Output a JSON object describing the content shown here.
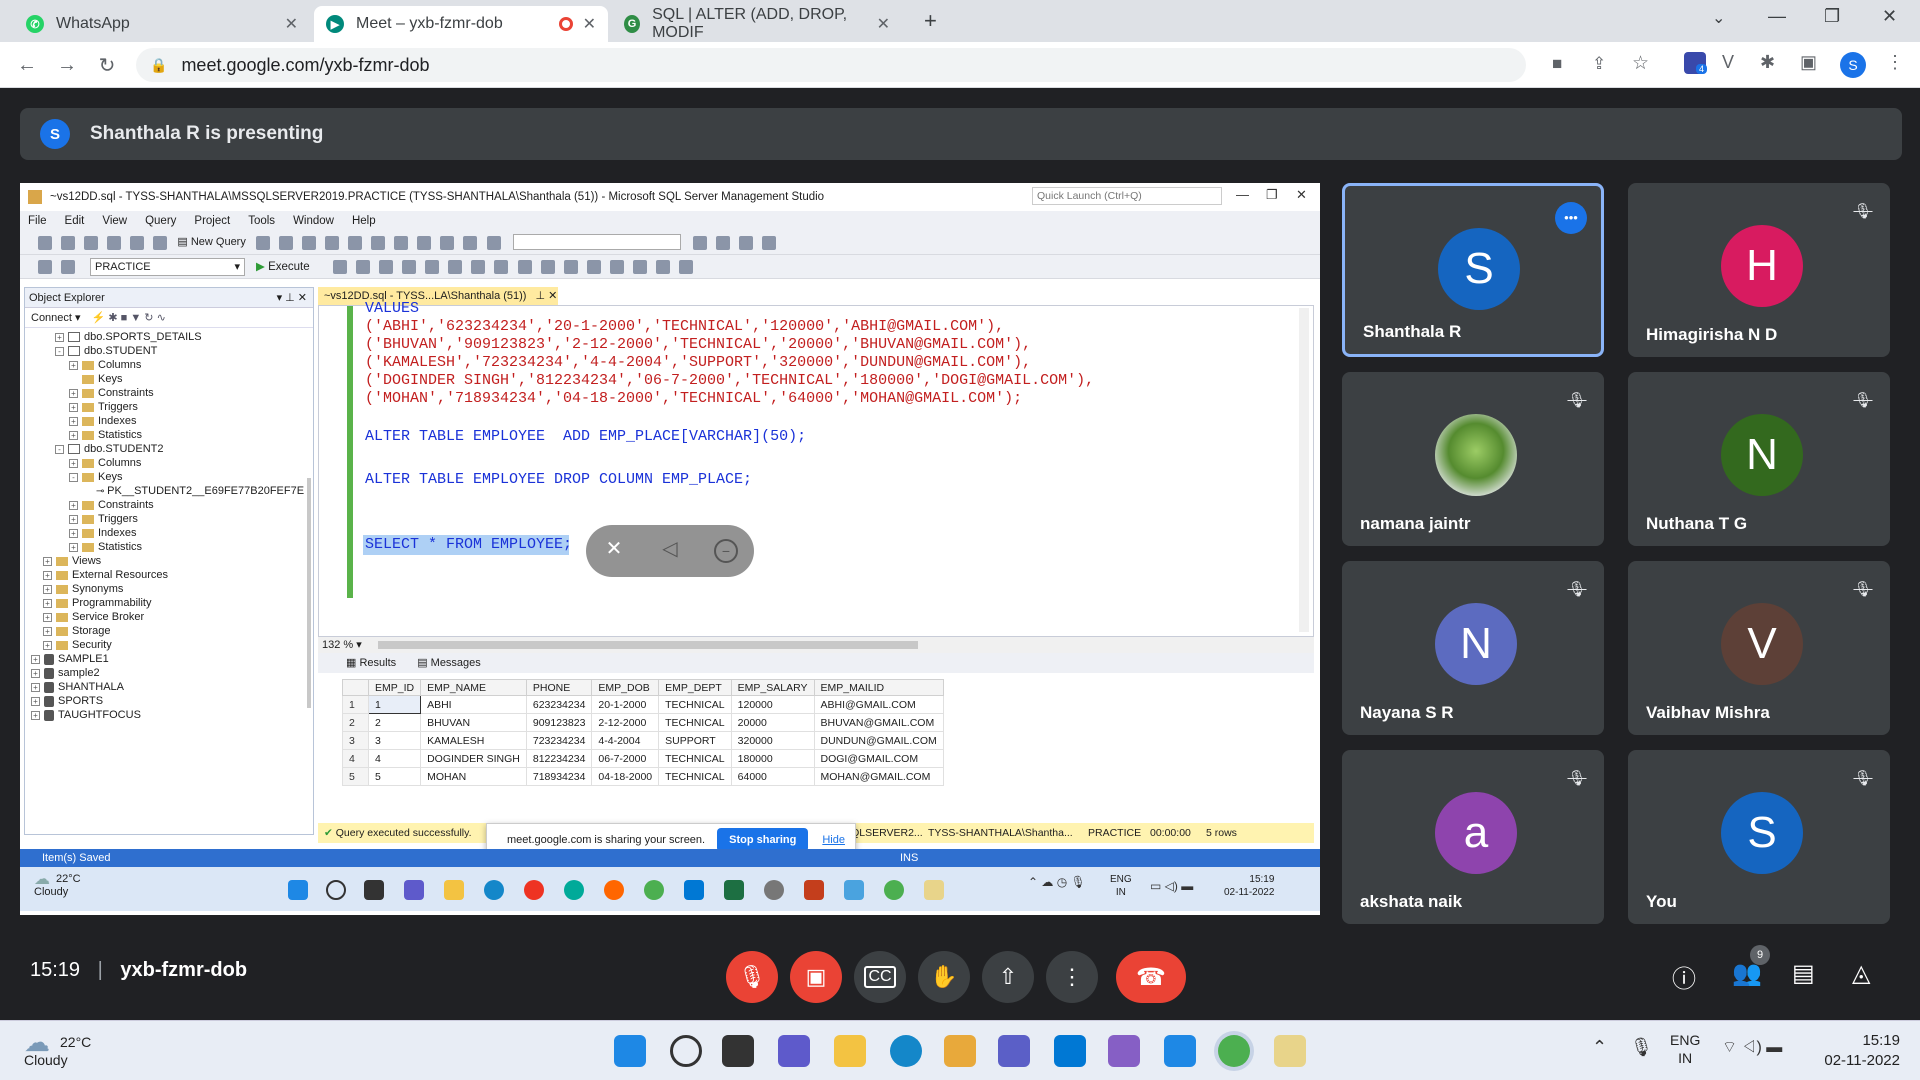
{
  "browser": {
    "tabs": [
      {
        "label": "WhatsApp",
        "icon": "whatsapp-icon"
      },
      {
        "label": "Meet – yxb-fzmr-dob",
        "icon": "meet-icon"
      },
      {
        "label": "SQL | ALTER (ADD, DROP, MODIF",
        "icon": "gfg-icon"
      }
    ],
    "url": "meet.google.com/yxb-fzmr-dob",
    "profile_initial": "S",
    "extension_badge": "4"
  },
  "meet": {
    "presenter_initial": "S",
    "presenting_text": "Shanthala R is presenting",
    "time": "15:19",
    "meeting_code": "yxb-fzmr-dob",
    "people_count": "9",
    "participants": [
      {
        "name": "Shanthala R",
        "initial": "S",
        "color": "#1565c0"
      },
      {
        "name": "Himagirisha N D",
        "initial": "H",
        "color": "#d81b60"
      },
      {
        "name": "namana jaintr",
        "initial": "",
        "color": "#7cb342"
      },
      {
        "name": "Nuthana T G",
        "initial": "N",
        "color": "#33691e"
      },
      {
        "name": "Nayana S R",
        "initial": "N",
        "color": "#5c6bc0"
      },
      {
        "name": "Vaibhav Mishra",
        "initial": "V",
        "color": "#5d4037"
      },
      {
        "name": "akshata naik",
        "initial": "a",
        "color": "#8e44ad"
      },
      {
        "name": "You",
        "initial": "S",
        "color": "#1565c0"
      }
    ]
  },
  "ssms": {
    "title": "~vs12DD.sql - TYSS-SHANTHALA\\MSSQLSERVER2019.PRACTICE (TYSS-SHANTHALA\\Shanthala (51)) - Microsoft SQL Server Management Studio",
    "quick_launch": "Quick Launch (Ctrl+Q)",
    "menu": [
      "File",
      "Edit",
      "View",
      "Query",
      "Project",
      "Tools",
      "Window",
      "Help"
    ],
    "new_query": "New Query",
    "database": "PRACTICE",
    "execute": "Execute",
    "object_explorer": "Object Explorer",
    "connect": "Connect",
    "doc_tab": "~vs12DD.sql - TYSS...LA\\Shanthala (51))",
    "tree": [
      {
        "label": "dbo.SPORTS_DETAILS",
        "kind": "table",
        "level": 2,
        "ex": "+"
      },
      {
        "label": "dbo.STUDENT",
        "kind": "table",
        "level": 2,
        "ex": "-"
      },
      {
        "label": "Columns",
        "kind": "folder",
        "level": 3,
        "ex": "+"
      },
      {
        "label": "Keys",
        "kind": "folder",
        "level": 3,
        "ex": ""
      },
      {
        "label": "Constraints",
        "kind": "folder",
        "level": 3,
        "ex": "+"
      },
      {
        "label": "Triggers",
        "kind": "folder",
        "level": 3,
        "ex": "+"
      },
      {
        "label": "Indexes",
        "kind": "folder",
        "level": 3,
        "ex": "+"
      },
      {
        "label": "Statistics",
        "kind": "folder",
        "level": 3,
        "ex": "+"
      },
      {
        "label": "dbo.STUDENT2",
        "kind": "table",
        "level": 2,
        "ex": "-"
      },
      {
        "label": "Columns",
        "kind": "folder",
        "level": 3,
        "ex": "+"
      },
      {
        "label": "Keys",
        "kind": "folder",
        "level": 3,
        "ex": "-"
      },
      {
        "label": "PK__STUDENT2__E69FE77B20FEF7E",
        "kind": "key",
        "level": 4,
        "ex": ""
      },
      {
        "label": "Constraints",
        "kind": "folder",
        "level": 3,
        "ex": "+"
      },
      {
        "label": "Triggers",
        "kind": "folder",
        "level": 3,
        "ex": "+"
      },
      {
        "label": "Indexes",
        "kind": "folder",
        "level": 3,
        "ex": "+"
      },
      {
        "label": "Statistics",
        "kind": "folder",
        "level": 3,
        "ex": "+"
      },
      {
        "label": "Views",
        "kind": "folder",
        "level": 1,
        "ex": "+"
      },
      {
        "label": "External Resources",
        "kind": "folder",
        "level": 1,
        "ex": "+"
      },
      {
        "label": "Synonyms",
        "kind": "folder",
        "level": 1,
        "ex": "+"
      },
      {
        "label": "Programmability",
        "kind": "folder",
        "level": 1,
        "ex": "+"
      },
      {
        "label": "Service Broker",
        "kind": "folder",
        "level": 1,
        "ex": "+"
      },
      {
        "label": "Storage",
        "kind": "folder",
        "level": 1,
        "ex": "+"
      },
      {
        "label": "Security",
        "kind": "folder",
        "level": 1,
        "ex": "+"
      },
      {
        "label": "SAMPLE1",
        "kind": "db",
        "level": 0,
        "ex": "+"
      },
      {
        "label": "sample2",
        "kind": "db",
        "level": 0,
        "ex": "+"
      },
      {
        "label": "SHANTHALA",
        "kind": "db",
        "level": 0,
        "ex": "+"
      },
      {
        "label": "SPORTS",
        "kind": "db",
        "level": 0,
        "ex": "+"
      },
      {
        "label": "TAUGHTFOCUS",
        "kind": "db",
        "level": 0,
        "ex": "+"
      }
    ],
    "code": {
      "values_kw": "VALUES",
      "rows": [
        "('ABHI','623234234','20-1-2000','TECHNICAL','120000','ABHI@GMAIL.COM'),",
        "('BHUVAN','909123823','2-12-2000','TECHNICAL','20000','BHUVAN@GMAIL.COM'),",
        "('KAMALESH','723234234','4-4-2004','SUPPORT','320000','DUNDUN@GMAIL.COM'),",
        "('DOGINDER SINGH','812234234','06-7-2000','TECHNICAL','180000','DOGI@GMAIL.COM'),",
        "('MOHAN','718934234','04-18-2000','TECHNICAL','64000','MOHAN@GMAIL.COM');"
      ],
      "alter_add": "ALTER TABLE EMPLOYEE  ADD EMP_PLACE[VARCHAR](50);",
      "alter_drop": "ALTER TABLE EMPLOYEE DROP COLUMN EMP_PLACE;",
      "select": "SELECT * FROM EMPLOYEE;"
    },
    "zoom": "132 %",
    "results_tab": "Results",
    "messages_tab": "Messages",
    "columns": [
      "EMP_ID",
      "EMP_NAME",
      "PHONE",
      "EMP_DOB",
      "EMP_DEPT",
      "EMP_SALARY",
      "EMP_MAILID"
    ],
    "rows": [
      [
        "1",
        "1",
        "ABHI",
        "623234234",
        "20-1-2000",
        "TECHNICAL",
        "120000",
        "ABHI@GMAIL.COM"
      ],
      [
        "2",
        "2",
        "BHUVAN",
        "909123823",
        "2-12-2000",
        "TECHNICAL",
        "20000",
        "BHUVAN@GMAIL.COM"
      ],
      [
        "3",
        "3",
        "KAMALESH",
        "723234234",
        "4-4-2004",
        "SUPPORT",
        "320000",
        "DUNDUN@GMAIL.COM"
      ],
      [
        "4",
        "4",
        "DOGINDER SINGH",
        "812234234",
        "06-7-2000",
        "TECHNICAL",
        "180000",
        "DOGI@GMAIL.COM"
      ],
      [
        "5",
        "5",
        "MOHAN",
        "718934234",
        "04-18-2000",
        "TECHNICAL",
        "64000",
        "MOHAN@GMAIL.COM"
      ]
    ],
    "status_ok": "Query executed successfully.",
    "status_server": "HALA\\MSSQLSERVER2...",
    "status_user": "TYSS-SHANTHALA\\Shantha...",
    "status_db": "PRACTICE",
    "status_time": "00:00:00",
    "status_rows": "5 rows",
    "item_saved": "Item(s) Saved",
    "ins": "INS",
    "sharing_text": "meet.google.com is sharing your screen.",
    "stop_sharing": "Stop sharing",
    "hide": "Hide",
    "inner_weather_temp": "22°C",
    "inner_weather_desc": "Cloudy",
    "inner_lang": "ENG",
    "inner_region": "IN",
    "inner_time": "15:19",
    "inner_date": "02-11-2022"
  },
  "taskbar": {
    "temp": "22°C",
    "desc": "Cloudy",
    "lang": "ENG",
    "region": "IN",
    "time": "15:19",
    "date": "02-11-2022"
  }
}
